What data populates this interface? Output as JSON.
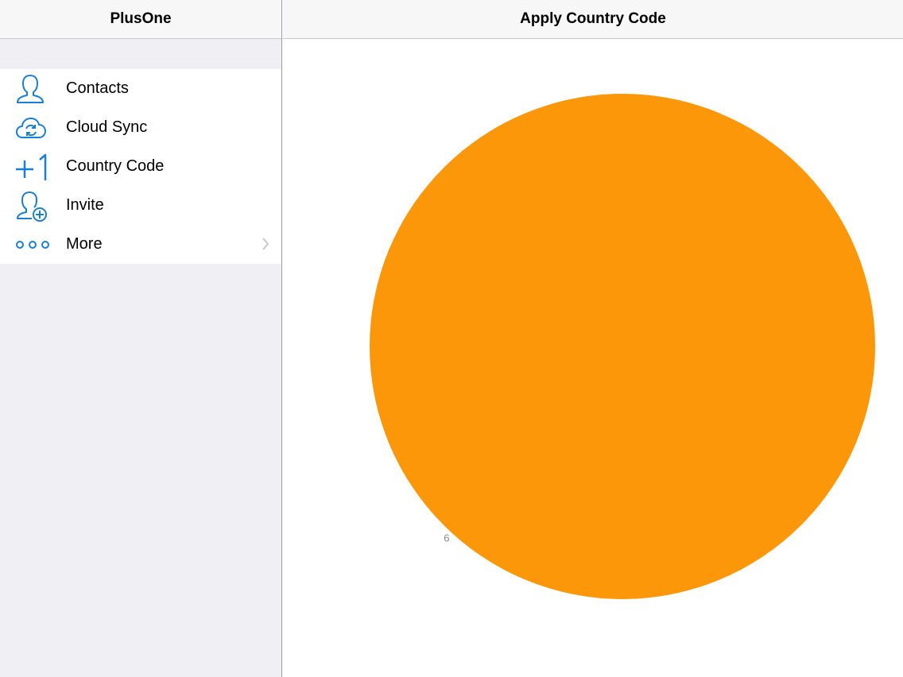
{
  "sidebar": {
    "title": "PlusOne",
    "items": [
      {
        "label": "Contacts",
        "icon": "contact-icon"
      },
      {
        "label": "Cloud Sync",
        "icon": "cloud-sync-icon"
      },
      {
        "label": "Country Code",
        "icon": "plus-one-icon"
      },
      {
        "label": "Invite",
        "icon": "add-contact-icon"
      },
      {
        "label": "More",
        "icon": "more-dots-icon",
        "accessory": "chevron-right-icon"
      }
    ]
  },
  "detail": {
    "title": "Apply Country Code"
  },
  "colors": {
    "accent": "#1a7fd4",
    "pie": "#fb9709",
    "sidebar_bg": "#efeff4"
  },
  "chart_data": {
    "type": "pie",
    "slices": [
      {
        "label": "6",
        "value": 6,
        "color": "#fb9709"
      }
    ]
  }
}
